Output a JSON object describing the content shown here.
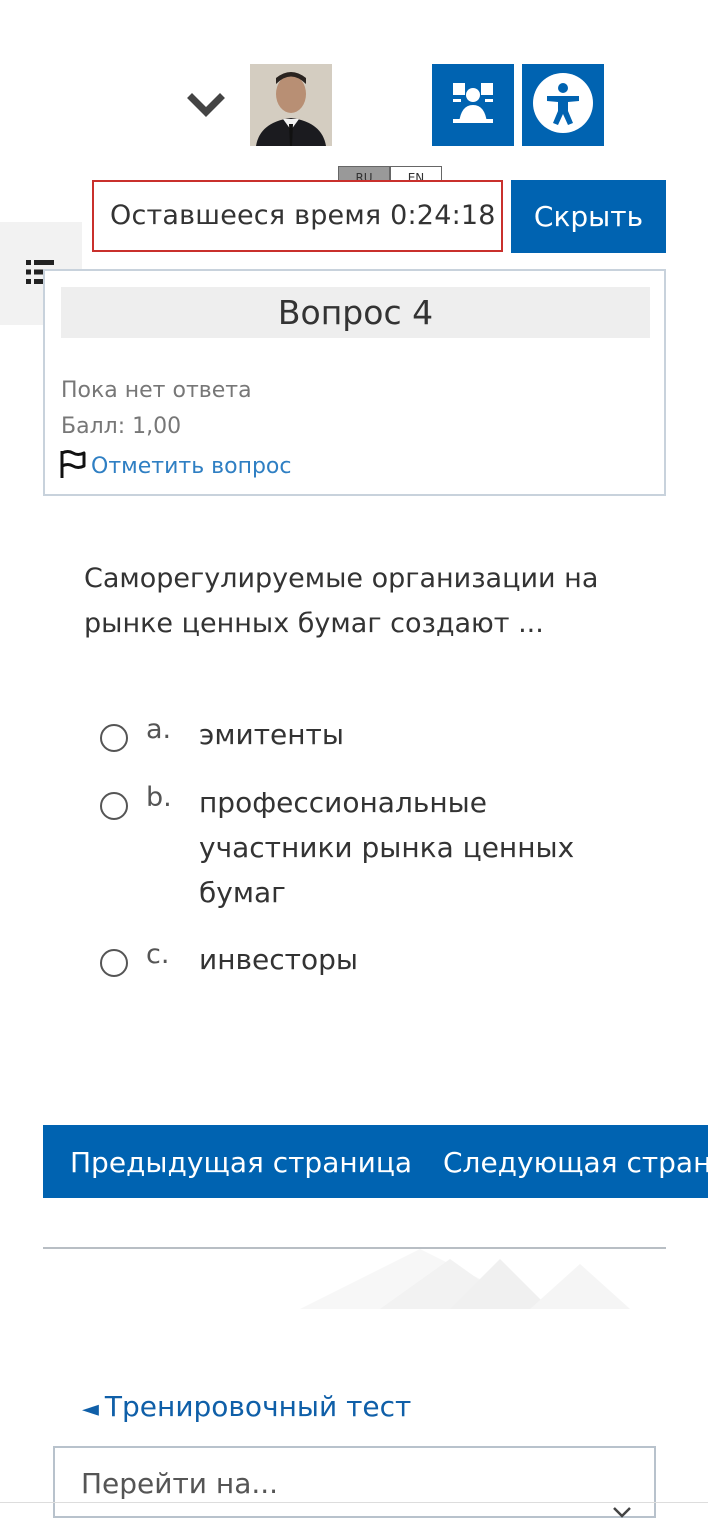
{
  "header": {
    "user_menu_icon": "chevron-down-icon",
    "avatar_alt": "user photo",
    "dyslexia_icon": "dyslexia-font-icon",
    "accessibility_icon": "accessibility-icon",
    "lang_ru": "RU",
    "lang_en": "EN"
  },
  "timer": {
    "label": "Оставшееся время 0:24:18",
    "hide_label": "Скрыть"
  },
  "drawer": {
    "icon": "list-icon"
  },
  "info": {
    "title": "Вопрос 4",
    "state": "Пока нет ответа",
    "grade": "Балл: 1,00",
    "flag_label": "Отметить вопрос"
  },
  "question": {
    "text": "Саморегулируемые организации на рынке ценных бумаг создают ...",
    "answers": [
      {
        "letter": "a.",
        "text": "эмитенты"
      },
      {
        "letter": "b.",
        "text": "профессиональные участники рынка ценных бумаг"
      },
      {
        "letter": "c.",
        "text": "инвесторы"
      }
    ]
  },
  "nav": {
    "prev": "Предыдущая страница",
    "next": "Следующая страница"
  },
  "footer": {
    "prev_activity": "Тренировочный тест",
    "jump_placeholder": "Перейти на..."
  },
  "colors": {
    "primary": "#0063b1",
    "timer_border": "#c9302c",
    "link": "#2f7fc3"
  }
}
